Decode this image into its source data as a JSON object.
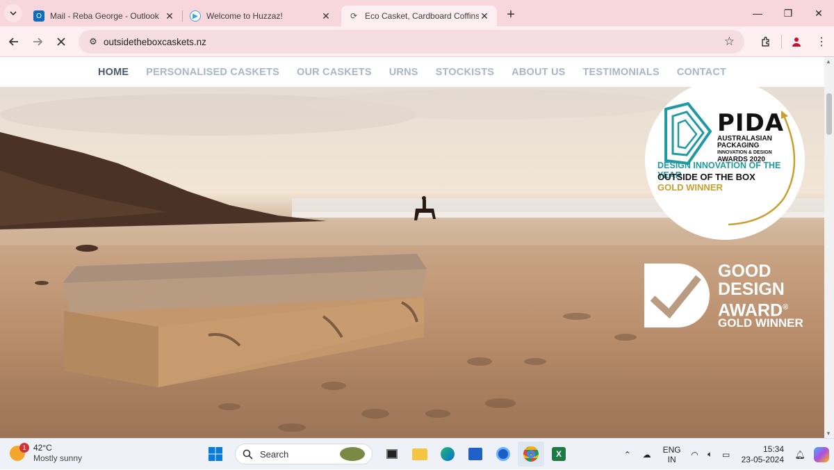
{
  "browser": {
    "tabs": [
      {
        "title": "Mail - Reba George - Outlook",
        "favicon": "outlook-icon",
        "active": false
      },
      {
        "title": "Welcome to Huzzaz!",
        "favicon": "huzzaz-icon",
        "active": false
      },
      {
        "title": "Eco Casket, Cardboard Coffins, N",
        "favicon": "loading-icon",
        "active": true
      }
    ],
    "url": "outsidetheboxcaskets.nz"
  },
  "site": {
    "nav": [
      "HOME",
      "PERSONALISED CASKETS",
      "OUR CASKETS",
      "URNS",
      "STOCKISTS",
      "ABOUT US",
      "TESTIMONIALS",
      "CONTACT"
    ],
    "pida": {
      "name": "PIDA",
      "sub": [
        "AUSTRALASIAN",
        "PACKAGING",
        "INNOVATION & DESIGN",
        "AWARDS 2020"
      ],
      "category": "DESIGN INNOVATION OF THE YEAR",
      "entry": "OUTSIDE OF THE BOX",
      "result": "GOLD WINNER"
    },
    "gda": {
      "lines": [
        "GOOD",
        "DESIGN",
        "AWARD"
      ],
      "mark": "®",
      "result": "GOLD WINNER"
    }
  },
  "taskbar": {
    "weather_temp": "42°C",
    "weather_desc": "Mostly sunny",
    "weather_badge": "1",
    "search_label": "Search",
    "lang_top": "ENG",
    "lang_bottom": "IN",
    "time": "15:34",
    "date": "23-05-2024"
  },
  "colors": {
    "tab_bar": "#f8d7dc",
    "nav_active": "#4a5a6a",
    "nav_inactive": "#a9b6c4",
    "pida_teal": "#1f9aa0",
    "pida_gold": "#c7a030"
  }
}
